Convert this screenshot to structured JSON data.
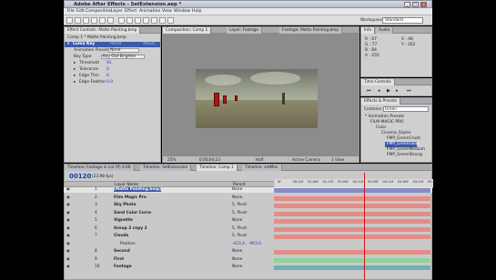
{
  "window": {
    "title": "Adobe After Effects - SetExtension.aep *",
    "min": "_",
    "max": "□",
    "close": "x"
  },
  "menu": [
    "File",
    "Edit",
    "Composition",
    "Layer",
    "Effect",
    "Animation",
    "View",
    "Window",
    "Help"
  ],
  "workspace": {
    "label": "Workspace:",
    "value": "Standard"
  },
  "effect_controls": {
    "tab": "Effect Controls: Matte Painting.bmp",
    "header": "Comp 1 * Matte Painting.bmp",
    "effect_name": "Luma Key",
    "reset": "Reset",
    "about": "About...",
    "anim_preset_label": "Animation Presets:",
    "anim_preset_value": "None",
    "key_type_label": "Key Type",
    "key_type_value": "Key Out Brighter",
    "params": [
      {
        "name": "Threshold",
        "value": "91"
      },
      {
        "name": "Tolerance",
        "value": "0"
      },
      {
        "name": "Edge Thin",
        "value": "0"
      },
      {
        "name": "Edge Feather",
        "value": "0.0"
      }
    ]
  },
  "viewer": {
    "tabs": [
      "Composition: Comp 1",
      "Layer: Footage",
      "Footage: Matte Painting.bmp"
    ],
    "zoom": "25%",
    "timecode": "0;00;04;23",
    "resolution": "Half",
    "camera": "Active Camera",
    "views": "1 View"
  },
  "info": {
    "tabs": [
      "Info",
      "Audio"
    ],
    "r": "R : 67",
    "g": "G : 77",
    "b": "B : 84",
    "a": "A : 255",
    "x": "X : 46",
    "y": "Y : 352"
  },
  "time_controls": {
    "title": "Time Controls"
  },
  "effects_presets": {
    "title": "Effects & Presets",
    "contains_label": "Contains:",
    "search": "Green",
    "items": [
      "* Animation Presets",
      "FILM MAGIC PRO",
      "Color",
      "Cinema_Styles",
      "FMP_GreenCrush",
      "FMP_GreenGlow",
      "FMP_GreenMedium",
      "FMP_GreenStrong"
    ]
  },
  "timeline": {
    "tabs": [
      "Timeline: Footage in Lnl (P) 4:06",
      "Timeline: SetExtension",
      "Timeline: Comp 1",
      "Timeline: setMov"
    ],
    "timecode": "00120",
    "fps": "(23.98 fps)",
    "col_layer": "Layer Name",
    "col_parent": "Parent",
    "ruler": [
      "0f",
      "00:12f",
      "01:00f",
      "01:12f",
      "02:00f",
      "02:12f",
      "03:00f",
      "03:12f",
      "04:00f",
      "04:12f",
      "05:00f"
    ],
    "layers": [
      {
        "num": "1",
        "name": "[Matte Painting.bmp]",
        "parent": "None"
      },
      {
        "num": "2",
        "name": "Film Magic Pro",
        "parent": "None"
      },
      {
        "num": "3",
        "name": "Sky Photo",
        "parent": "5. Pivot"
      },
      {
        "num": "4",
        "name": "Sand Color Corre",
        "parent": "5. Pivot"
      },
      {
        "num": "5",
        "name": "Vignette",
        "parent": "None"
      },
      {
        "num": "6",
        "name": "Group 2 copy 2",
        "parent": "5. Pivot"
      },
      {
        "num": "7",
        "name": "Clouds",
        "parent": "5. Pivot"
      },
      {
        "num": "",
        "name": "Position",
        "parent": "-423.4 , -963.0"
      },
      {
        "num": "8",
        "name": "Second",
        "parent": "None"
      },
      {
        "num": "9",
        "name": "First",
        "parent": "None"
      },
      {
        "num": "10",
        "name": "Footage",
        "parent": "None"
      }
    ]
  },
  "colors": {
    "panel": "#cfcfcf",
    "track_purple": "#8a8ac4",
    "track_red": "#e38d86",
    "track_green": "#8fd29c",
    "track_teal": "#6fb0b5",
    "playhead": "#d21616"
  }
}
